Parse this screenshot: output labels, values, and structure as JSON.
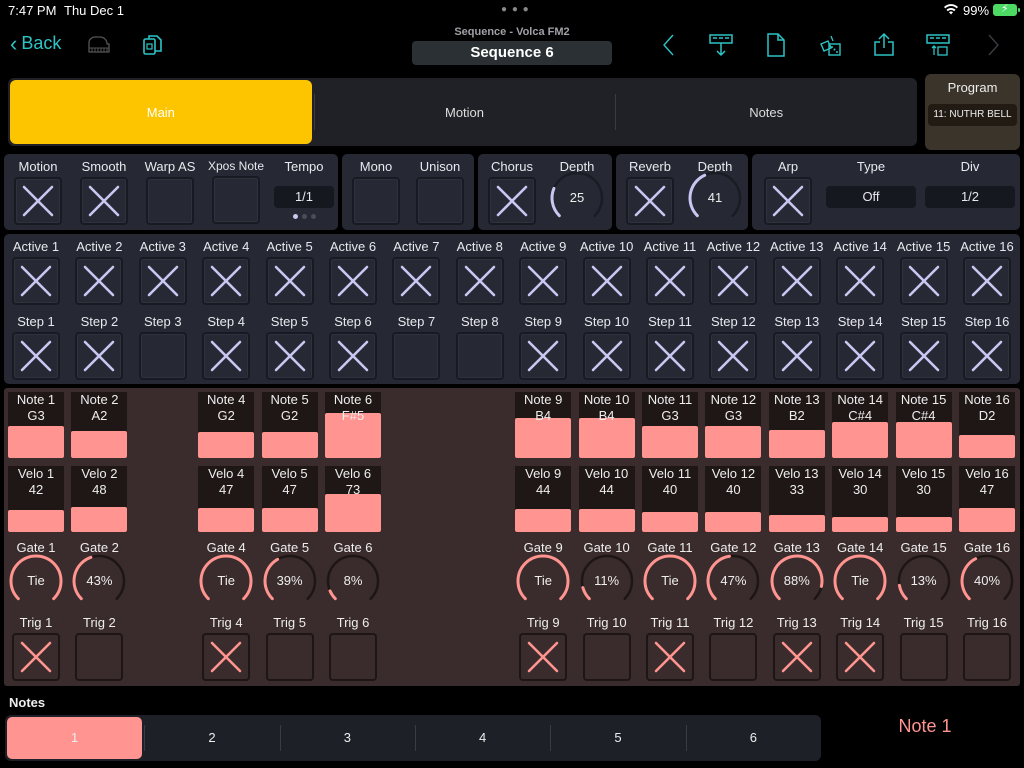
{
  "status": {
    "time": "7:47 PM",
    "date": "Thu Dec 1",
    "battery": "99%"
  },
  "nav": {
    "back_label": "Back",
    "subtitle": "Sequence - Volca FM2",
    "title": "Sequence 6",
    "icons": [
      "piano-icon",
      "copy-icon",
      "previous-icon",
      "load-pattern-icon",
      "new-document-icon",
      "randomize-dice-icon",
      "share-icon",
      "save-pattern-icon",
      "next-icon"
    ]
  },
  "tabs": [
    {
      "label": "Main",
      "active": true
    },
    {
      "label": "Motion",
      "active": false
    },
    {
      "label": "Notes",
      "active": false
    }
  ],
  "program": {
    "label": "Program",
    "value": "11: NUTHR BELL"
  },
  "main_panel": {
    "motion": {
      "label": "Motion",
      "checked": true
    },
    "smooth": {
      "label": "Smooth",
      "checked": true
    },
    "warp_as": {
      "label": "Warp AS",
      "checked": false
    },
    "xpos_note": {
      "label": "Xpos Note",
      "checked": false
    },
    "tempo": {
      "label": "Tempo",
      "value": "1/1",
      "page": 1,
      "pages": 3
    }
  },
  "voice_panel": {
    "mono": {
      "label": "Mono",
      "checked": false
    },
    "unison": {
      "label": "Unison",
      "checked": false
    }
  },
  "chorus_panel": {
    "chorus": {
      "label": "Chorus",
      "checked": true
    },
    "depth": {
      "label": "Depth",
      "value": "25",
      "fraction": 0.25
    }
  },
  "reverb_panel": {
    "reverb": {
      "label": "Reverb",
      "checked": true
    },
    "depth": {
      "label": "Depth",
      "value": "41",
      "fraction": 0.41
    }
  },
  "arp_panel": {
    "arp": {
      "label": "Arp",
      "checked": true
    },
    "type": {
      "label": "Type",
      "value": "Off"
    },
    "div": {
      "label": "Div",
      "value": "1/2"
    }
  },
  "active": [
    {
      "label": "Active 1",
      "checked": true
    },
    {
      "label": "Active 2",
      "checked": true
    },
    {
      "label": "Active 3",
      "checked": true
    },
    {
      "label": "Active 4",
      "checked": true
    },
    {
      "label": "Active 5",
      "checked": true
    },
    {
      "label": "Active 6",
      "checked": true
    },
    {
      "label": "Active 7",
      "checked": true
    },
    {
      "label": "Active 8",
      "checked": true
    },
    {
      "label": "Active 9",
      "checked": true
    },
    {
      "label": "Active 10",
      "checked": true
    },
    {
      "label": "Active 11",
      "checked": true
    },
    {
      "label": "Active 12",
      "checked": true
    },
    {
      "label": "Active 13",
      "checked": true
    },
    {
      "label": "Active 14",
      "checked": true
    },
    {
      "label": "Active 15",
      "checked": true
    },
    {
      "label": "Active 16",
      "checked": true
    }
  ],
  "step": [
    {
      "label": "Step 1",
      "checked": true
    },
    {
      "label": "Step 2",
      "checked": true
    },
    {
      "label": "Step 3",
      "checked": false
    },
    {
      "label": "Step 4",
      "checked": true
    },
    {
      "label": "Step 5",
      "checked": true
    },
    {
      "label": "Step 6",
      "checked": true
    },
    {
      "label": "Step 7",
      "checked": false
    },
    {
      "label": "Step 8",
      "checked": false
    },
    {
      "label": "Step 9",
      "checked": true
    },
    {
      "label": "Step 10",
      "checked": true
    },
    {
      "label": "Step 11",
      "checked": true
    },
    {
      "label": "Step 12",
      "checked": true
    },
    {
      "label": "Step 13",
      "checked": true
    },
    {
      "label": "Step 14",
      "checked": true
    },
    {
      "label": "Step 15",
      "checked": true
    },
    {
      "label": "Step 16",
      "checked": true
    }
  ],
  "steps": [
    {
      "n": 1,
      "note": "Note 1",
      "note_val": "G3",
      "note_level": 0.6,
      "velo": "Velo 1",
      "velo_val": "42",
      "velo_level": 0.33,
      "gate": "Gate 1",
      "gate_val": "Tie",
      "gate_level": 1.0,
      "trig": "Trig 1",
      "trig_on": true
    },
    {
      "n": 2,
      "note": "Note 2",
      "note_val": "A2",
      "note_level": 0.5,
      "velo": "Velo 2",
      "velo_val": "48",
      "velo_level": 0.38,
      "gate": "Gate 2",
      "gate_val": "43%",
      "gate_level": 0.43,
      "trig": "Trig 2",
      "trig_on": false
    },
    {
      "n": 4,
      "note": "Note 4",
      "note_val": "G2",
      "note_level": 0.48,
      "velo": "Velo 4",
      "velo_val": "47",
      "velo_level": 0.37,
      "gate": "Gate 4",
      "gate_val": "Tie",
      "gate_level": 1.0,
      "trig": "Trig 4",
      "trig_on": true
    },
    {
      "n": 5,
      "note": "Note 5",
      "note_val": "G2",
      "note_level": 0.48,
      "velo": "Velo 5",
      "velo_val": "47",
      "velo_level": 0.37,
      "gate": "Gate 5",
      "gate_val": "39%",
      "gate_level": 0.39,
      "trig": "Trig 5",
      "trig_on": false
    },
    {
      "n": 6,
      "note": "Note 6",
      "note_val": "F#5",
      "note_level": 0.84,
      "velo": "Velo 6",
      "velo_val": "73",
      "velo_level": 0.57,
      "gate": "Gate 6",
      "gate_val": "8%",
      "gate_level": 0.08,
      "trig": "Trig 6",
      "trig_on": false
    },
    {
      "n": 9,
      "note": "Note 9",
      "note_val": "B4",
      "note_level": 0.74,
      "velo": "Velo 9",
      "velo_val": "44",
      "velo_level": 0.35,
      "gate": "Gate 9",
      "gate_val": "Tie",
      "gate_level": 1.0,
      "trig": "Trig 9",
      "trig_on": true
    },
    {
      "n": 10,
      "note": "Note 10",
      "note_val": "B4",
      "note_level": 0.74,
      "velo": "Velo 10",
      "velo_val": "44",
      "velo_level": 0.35,
      "gate": "Gate 10",
      "gate_val": "11%",
      "gate_level": 0.11,
      "trig": "Trig 10",
      "trig_on": false
    },
    {
      "n": 11,
      "note": "Note 11",
      "note_val": "G3",
      "note_level": 0.6,
      "velo": "Velo 11",
      "velo_val": "40",
      "velo_level": 0.31,
      "gate": "Gate 11",
      "gate_val": "Tie",
      "gate_level": 1.0,
      "trig": "Trig 11",
      "trig_on": true
    },
    {
      "n": 12,
      "note": "Note 12",
      "note_val": "G3",
      "note_level": 0.6,
      "velo": "Velo 12",
      "velo_val": "40",
      "velo_level": 0.31,
      "gate": "Gate 12",
      "gate_val": "47%",
      "gate_level": 0.47,
      "trig": "Trig 12",
      "trig_on": false
    },
    {
      "n": 13,
      "note": "Note 13",
      "note_val": "B2",
      "note_level": 0.52,
      "velo": "Velo 13",
      "velo_val": "33",
      "velo_level": 0.26,
      "gate": "Gate 13",
      "gate_val": "88%",
      "gate_level": 0.88,
      "trig": "Trig 13",
      "trig_on": true
    },
    {
      "n": 14,
      "note": "Note 14",
      "note_val": "C#4",
      "note_level": 0.66,
      "velo": "Velo 14",
      "velo_val": "30",
      "velo_level": 0.23,
      "gate": "Gate 14",
      "gate_val": "Tie",
      "gate_level": 1.0,
      "trig": "Trig 14",
      "trig_on": true
    },
    {
      "n": 15,
      "note": "Note 15",
      "note_val": "C#4",
      "note_level": 0.66,
      "velo": "Velo 15",
      "velo_val": "30",
      "velo_level": 0.23,
      "gate": "Gate 15",
      "gate_val": "13%",
      "gate_level": 0.13,
      "trig": "Trig 15",
      "trig_on": false
    },
    {
      "n": 16,
      "note": "Note 16",
      "note_val": "D2",
      "note_level": 0.42,
      "velo": "Velo 16",
      "velo_val": "47",
      "velo_level": 0.37,
      "gate": "Gate 16",
      "gate_val": "40%",
      "gate_level": 0.4,
      "trig": "Trig 16",
      "trig_on": false
    }
  ],
  "notes_footer": {
    "label": "Notes",
    "segments": [
      "1",
      "2",
      "3",
      "4",
      "5",
      "6"
    ],
    "selected": 0,
    "selected_label": "Note 1"
  },
  "colors": {
    "accent_yellow": "#fcc500",
    "accent_teal": "#2ec4c6",
    "note_pink": "#ff9490",
    "check_lavender": "#c9c6f2"
  }
}
